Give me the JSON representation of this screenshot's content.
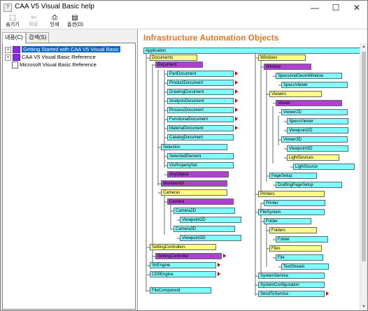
{
  "window": {
    "title": "CAA V5 Visual Basic help",
    "controls": {
      "minimize": "—",
      "maximize": "☐",
      "close": "✕"
    }
  },
  "toolbar": {
    "buttons": [
      {
        "label": "숨기기",
        "icon": "hide-icon",
        "glyph": "⬚"
      },
      {
        "label": "뒤로",
        "icon": "back-arrow-icon",
        "glyph": "⇦"
      },
      {
        "label": "인쇄",
        "icon": "printer-icon",
        "glyph": "⎙"
      },
      {
        "label": "옵션(O)",
        "icon": "options-icon",
        "glyph": "▤"
      }
    ]
  },
  "nav": {
    "tabs": [
      "내용(C)",
      "검색(S)"
    ],
    "tree": [
      {
        "label": "Getting Started with CAA V5 Visual Basic",
        "icon": "book-icon",
        "expander": "+",
        "selected": true
      },
      {
        "label": "CAA V5 Visual Basic Reference",
        "icon": "book-icon",
        "expander": "+",
        "selected": false
      },
      {
        "label": "Microsoft Visual Basic Reference",
        "icon": "help-page-icon",
        "expander": "",
        "selected": false
      }
    ]
  },
  "content": {
    "heading": "Infrastructure Automation Objects",
    "colors": {
      "heading": "#e8721c",
      "collection": "#ffff88",
      "object": "#7fffff",
      "abstract": "#b040d0",
      "arrow": "#c00000"
    },
    "objects": [
      {
        "label": "Application",
        "kind": "app"
      },
      {
        "label": "Documents",
        "kind": "collection"
      },
      {
        "label": "Document",
        "kind": "abstract"
      },
      {
        "label": "PartDocument",
        "kind": "object",
        "more": true
      },
      {
        "label": "ProductDocument",
        "kind": "object",
        "more": true
      },
      {
        "label": "DrawingDocument",
        "kind": "object",
        "more": true
      },
      {
        "label": "AnalysisDocument",
        "kind": "object",
        "more": true
      },
      {
        "label": "ProcessDocument",
        "kind": "object",
        "more": true
      },
      {
        "label": "FunctionalDocument",
        "kind": "object",
        "more": true
      },
      {
        "label": "MaterialDocument",
        "kind": "object",
        "more": true
      },
      {
        "label": "CatalogDocument",
        "kind": "object"
      },
      {
        "label": "Selection",
        "kind": "object"
      },
      {
        "label": "SelectedElement",
        "kind": "object"
      },
      {
        "label": "VisPropertySet",
        "kind": "object"
      },
      {
        "label": "AnyObject",
        "kind": "abstract"
      },
      {
        "label": "Workbench",
        "kind": "abstract"
      },
      {
        "label": "Cameras",
        "kind": "collection"
      },
      {
        "label": "Camera",
        "kind": "abstract"
      },
      {
        "label": "Camera2D",
        "kind": "object"
      },
      {
        "label": "Viewpoint2D",
        "kind": "object"
      },
      {
        "label": "Camera3D",
        "kind": "object"
      },
      {
        "label": "Viewpoint3D",
        "kind": "object"
      },
      {
        "label": "SettingControllers",
        "kind": "collection"
      },
      {
        "label": "SettingController",
        "kind": "abstract",
        "more": true
      },
      {
        "label": "StrEngine",
        "kind": "object",
        "more": true
      },
      {
        "label": "CD5Engine",
        "kind": "object",
        "more": true
      },
      {
        "label": "FileComponent",
        "kind": "object"
      },
      {
        "label": "Windows",
        "kind": "collection"
      },
      {
        "label": "Window",
        "kind": "abstract"
      },
      {
        "label": "SpecsAndGeomWindow",
        "kind": "object"
      },
      {
        "label": "SpecsViewer",
        "kind": "object"
      },
      {
        "label": "Viewers",
        "kind": "collection"
      },
      {
        "label": "Viewer",
        "kind": "abstract"
      },
      {
        "label": "Viewer2D",
        "kind": "object"
      },
      {
        "label": "SpecsViewer",
        "kind": "object"
      },
      {
        "label": "Viewpoint2D",
        "kind": "object"
      },
      {
        "label": "Viewer3D",
        "kind": "object"
      },
      {
        "label": "Viewpoint3D",
        "kind": "object"
      },
      {
        "label": "LightSources",
        "kind": "collection"
      },
      {
        "label": "LightSource",
        "kind": "object"
      },
      {
        "label": "PageSetup",
        "kind": "object"
      },
      {
        "label": "DraftingPageSetup",
        "kind": "object"
      },
      {
        "label": "Printers",
        "kind": "collection"
      },
      {
        "label": "Printer",
        "kind": "object"
      },
      {
        "label": "FileSystem",
        "kind": "object"
      },
      {
        "label": "Folder",
        "kind": "object"
      },
      {
        "label": "Folders",
        "kind": "collection"
      },
      {
        "label": "Folder",
        "kind": "object"
      },
      {
        "label": "Files",
        "kind": "collection"
      },
      {
        "label": "File",
        "kind": "object"
      },
      {
        "label": "TextStream",
        "kind": "object"
      },
      {
        "label": "SystemService",
        "kind": "object"
      },
      {
        "label": "SystemConfiguration",
        "kind": "object"
      },
      {
        "label": "SendToService",
        "kind": "object",
        "more": true
      }
    ]
  }
}
